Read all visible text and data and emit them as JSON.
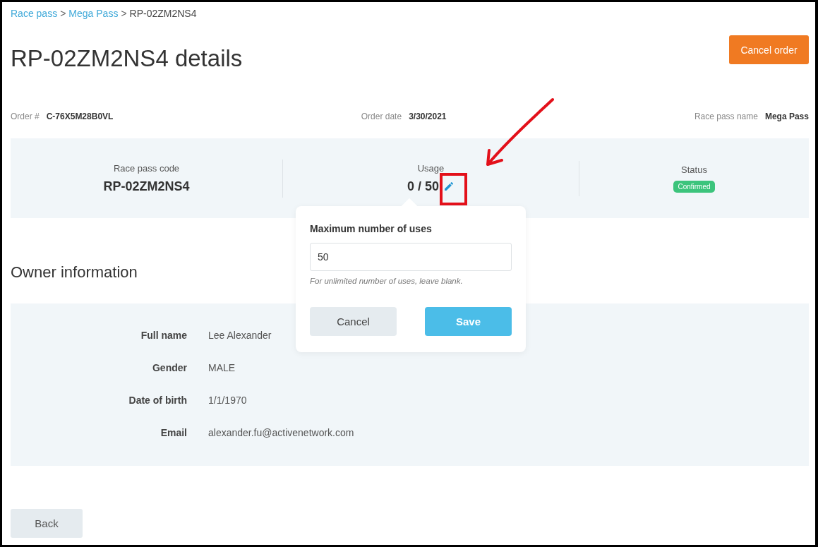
{
  "breadcrumb": [
    {
      "label": "Race pass",
      "link": true
    },
    {
      "label": "Mega Pass",
      "link": true
    },
    {
      "label": "RP-02ZM2NS4",
      "link": false
    }
  ],
  "breadcrumb_separator": ">",
  "title": "RP-02ZM2NS4 details",
  "cancel_order_button": "Cancel order",
  "meta": [
    {
      "label": "Order #",
      "value": "C-76X5M28B0VL"
    },
    {
      "label": "Order date",
      "value": "3/30/2021"
    },
    {
      "label": "Race pass name",
      "value": "Mega Pass"
    }
  ],
  "summary": {
    "code_label": "Race pass code",
    "code": "RP-02ZM2NS4",
    "usage_label": "Usage",
    "usage": "0 / 50",
    "status_label": "Status",
    "status": "Confirmed"
  },
  "usage_popover": {
    "label": "Maximum number of uses",
    "value": "50",
    "hint": "For unlimited number of uses, leave blank.",
    "cancel": "Cancel",
    "save": "Save"
  },
  "owner": {
    "heading": "Owner information",
    "fields": [
      {
        "label": "Full name",
        "value": "Lee Alexander"
      },
      {
        "label": "Gender",
        "value": "MALE"
      },
      {
        "label": "Date of birth",
        "value": "1/1/1970"
      },
      {
        "label": "Email",
        "value": "alexander.fu@activenetwork.com"
      }
    ]
  },
  "back_button": "Back"
}
